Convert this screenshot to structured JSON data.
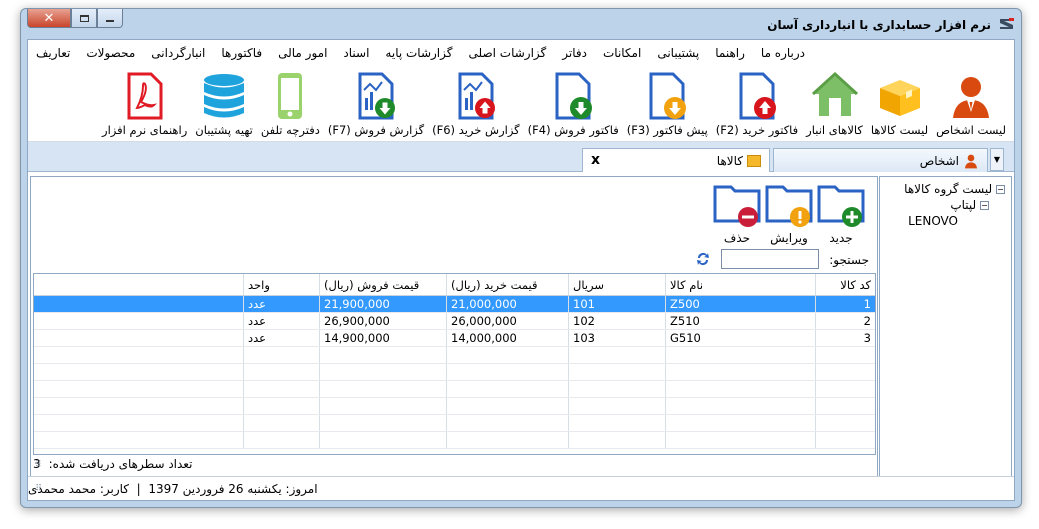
{
  "window": {
    "title": "نرم افزار حسابداری با انبارداری آسان"
  },
  "menu": [
    "تعاریف",
    "محصولات",
    "انبارگردانی",
    "فاکتورها",
    "امور مالی",
    "اسناد",
    "گزارشات پایه",
    "گزارشات اصلی",
    "دفاتر",
    "امکانات",
    "پشتیبانی",
    "راهنما",
    "درباره ما"
  ],
  "toolbar": [
    {
      "label": "لیست اشخاص",
      "icon": "person-icon"
    },
    {
      "label": "لیست کالاها",
      "icon": "box-icon"
    },
    {
      "label": "کالاهای انبار",
      "icon": "warehouse-icon"
    },
    {
      "label": "فاکتور خرید (F2)",
      "icon": "purchase-invoice-icon"
    },
    {
      "label": "پیش فاکتور (F3)",
      "icon": "pre-invoice-icon"
    },
    {
      "label": "فاکتور فروش (F4)",
      "icon": "sales-invoice-icon"
    },
    {
      "label": "گزارش خرید (F6)",
      "icon": "purchase-report-icon"
    },
    {
      "label": "گزارش فروش (F7)",
      "icon": "sales-report-icon"
    },
    {
      "label": "دفترچه تلفن",
      "icon": "phone-icon"
    },
    {
      "label": "تهیه پشتیبان",
      "icon": "database-icon"
    },
    {
      "label": "راهنمای نرم افزار",
      "icon": "pdf-icon"
    }
  ],
  "tabs": {
    "active": "کالاها",
    "other": "اشخاص",
    "close": "x"
  },
  "tree": {
    "root": "لیست گروه کالاها",
    "group": "لپتاپ",
    "item": "LENOVO"
  },
  "actions": {
    "new": "جدید",
    "edit": "ویرایش",
    "delete": "حذف"
  },
  "search": {
    "label": "جستجو:",
    "value": ""
  },
  "grid": {
    "headers": {
      "code": "کد کالا",
      "name": "نام کالا",
      "serial": "سریال",
      "buy": "قیمت خرید (ریال)",
      "sell": "قیمت فروش (ریال)",
      "unit": "واحد"
    },
    "rows": [
      {
        "code": "1",
        "name": "Z500",
        "serial": "101",
        "buy": "21,000,000",
        "sell": "21,900,000",
        "unit": "عدد"
      },
      {
        "code": "2",
        "name": "Z510",
        "serial": "102",
        "buy": "26,000,000",
        "sell": "26,900,000",
        "unit": "عدد"
      },
      {
        "code": "3",
        "name": "G510",
        "serial": "103",
        "buy": "14,000,000",
        "sell": "14,900,000",
        "unit": "عدد"
      }
    ]
  },
  "count": {
    "label": "تعداد سطرهای دریافت شده:",
    "value": "3"
  },
  "status": {
    "text": "امروز: یکشنبه 26 فروردین 1397  |  کاربر: محمد محمدی"
  }
}
